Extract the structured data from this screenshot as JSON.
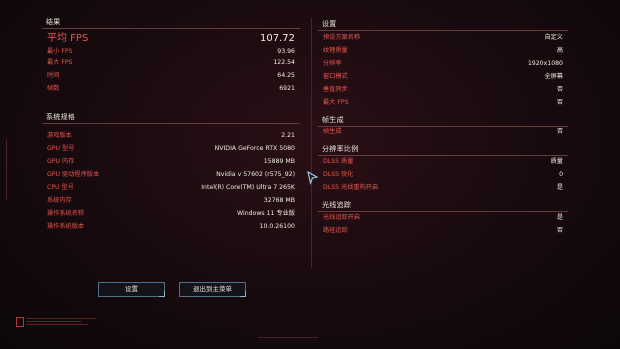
{
  "summary": {
    "title": "结果",
    "fps_label": "平均 FPS",
    "fps_value": "107.72",
    "rows": [
      {
        "label": "最小 FPS",
        "value": "93.96"
      },
      {
        "label": "最大 FPS",
        "value": "122.54"
      },
      {
        "label": "时间",
        "value": "64.25"
      },
      {
        "label": "帧数",
        "value": "6921"
      }
    ]
  },
  "system": {
    "title": "系统规格",
    "rows": [
      {
        "label": "游戏版本",
        "value": "2.21"
      },
      {
        "label": "GPU 型号",
        "value": "NVIDIA GeForce RTX 5080"
      },
      {
        "label": "GPU 内存",
        "value": "15889 MB"
      },
      {
        "label": "GPU 驱动程序版本",
        "value": "Nvidia v 57602 (r575_92)"
      },
      {
        "label": "CPU 型号",
        "value": "Intel(R) Core(TM) Ultra 7 265K"
      },
      {
        "label": "系统内存",
        "value": "32768 MB"
      },
      {
        "label": "操作系统名称",
        "value": "Windows 11 专业版"
      },
      {
        "label": "操作系统版本",
        "value": "10.0.26100"
      }
    ]
  },
  "settings": {
    "title": "设置",
    "rows": [
      {
        "label": "预设方案名称",
        "value": "自定义"
      },
      {
        "label": "纹理质量",
        "value": "高"
      },
      {
        "label": "分辨率",
        "value": "1920x1080"
      },
      {
        "label": "窗口模式",
        "value": "全屏幕"
      },
      {
        "label": "垂直同步",
        "value": "否"
      },
      {
        "label": "最大 FPS",
        "value": "否"
      }
    ]
  },
  "frame_gen": {
    "title": "帧生成",
    "rows": [
      {
        "label": "帧生成",
        "value": "否"
      }
    ]
  },
  "resolution_scaling": {
    "title": "分辨率比例",
    "rows": [
      {
        "label": "DLSS 质量",
        "value": "质量"
      },
      {
        "label": "DLSS 锐化",
        "value": "0"
      },
      {
        "label": "DLSS 光线重构开启",
        "value": "是"
      }
    ]
  },
  "ray_tracing": {
    "title": "光线追踪",
    "rows": [
      {
        "label": "光线追踪开启",
        "value": "是"
      },
      {
        "label": "路径追踪",
        "value": "否"
      }
    ]
  },
  "buttons": {
    "settings_label": "设置",
    "exit_label": "退出到主菜单"
  }
}
